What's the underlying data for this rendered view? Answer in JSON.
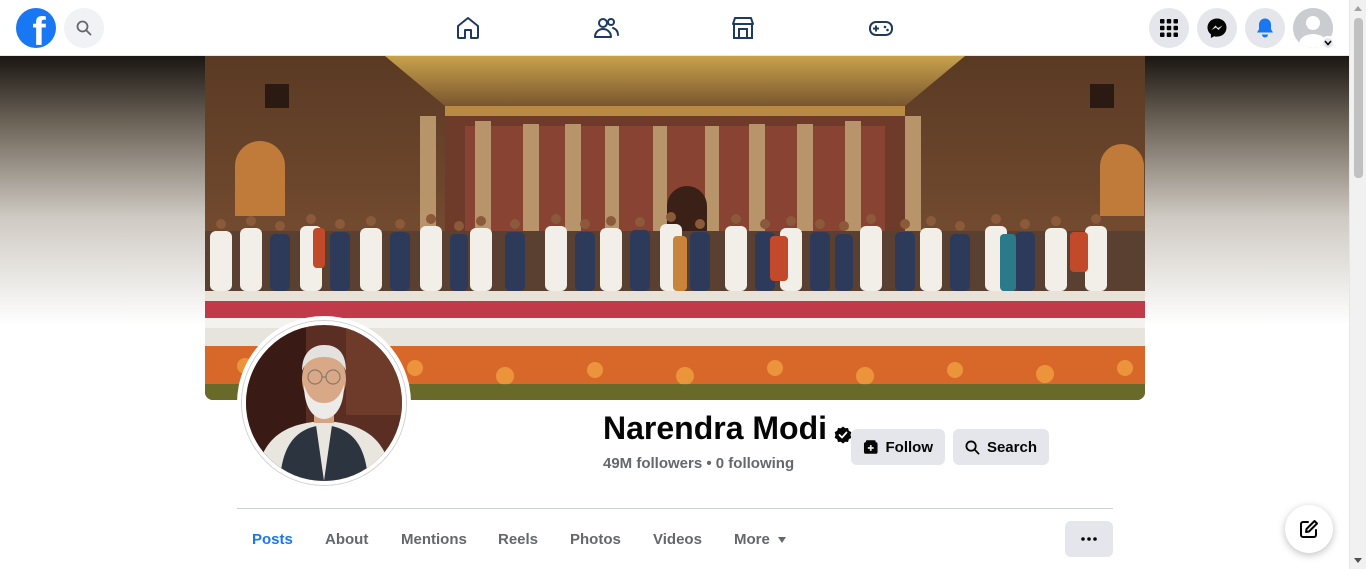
{
  "topbar": {
    "logo_letter": "f",
    "nav": [
      "home-icon",
      "friends-icon",
      "marketplace-icon",
      "gaming-icon"
    ],
    "right": [
      "menu-grid-icon",
      "messenger-icon",
      "notifications-bell-icon",
      "account-avatar"
    ]
  },
  "profile": {
    "name": "Narendra Modi",
    "followers_text": "49M followers • 0 following",
    "follow_label": "Follow",
    "search_label": "Search"
  },
  "tabs": [
    {
      "label": "Posts",
      "active": true
    },
    {
      "label": "About"
    },
    {
      "label": "Mentions"
    },
    {
      "label": "Reels"
    },
    {
      "label": "Photos"
    },
    {
      "label": "Videos"
    },
    {
      "label": "More"
    }
  ],
  "colors": {
    "accent": "#1877f2",
    "button_bg": "#e4e6eb",
    "secondary_text": "#65676b"
  }
}
